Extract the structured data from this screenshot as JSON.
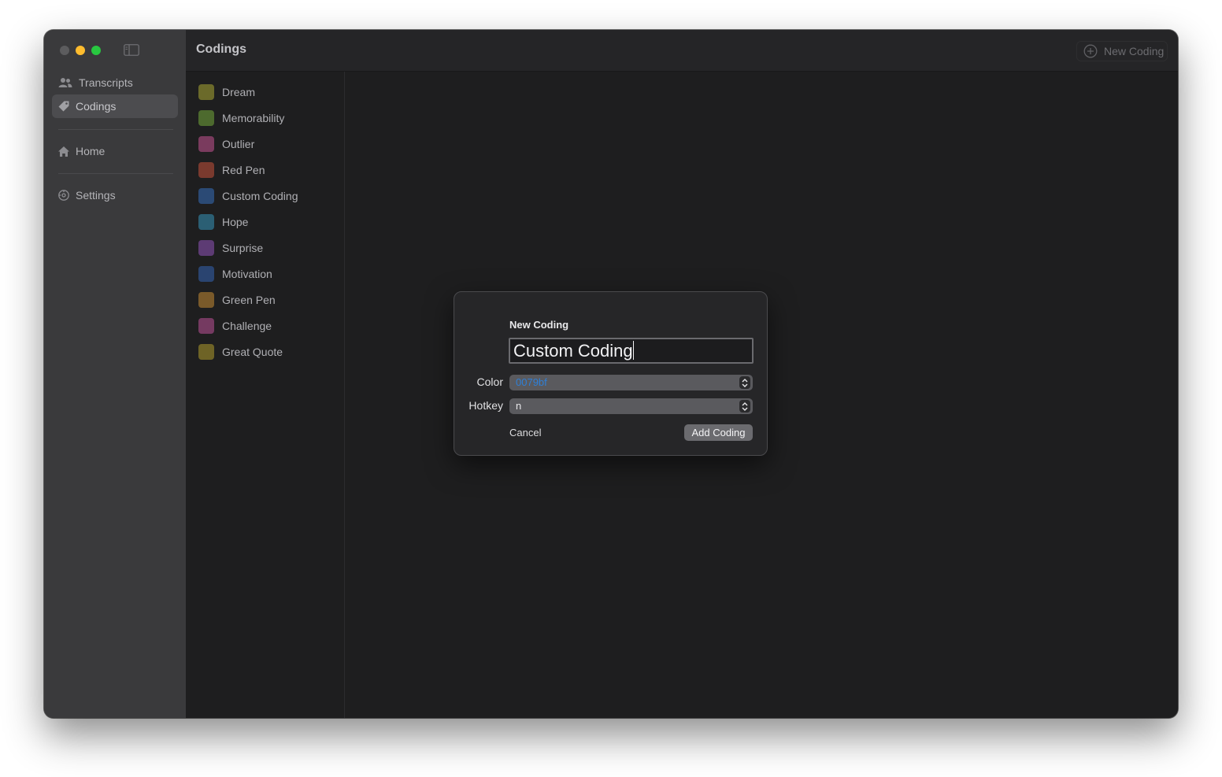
{
  "sidebar": {
    "items": [
      {
        "label": "Transcripts",
        "icon": "people-icon"
      },
      {
        "label": "Codings",
        "icon": "tag-icon",
        "selected": true
      },
      {
        "label": "Home",
        "icon": "house-icon"
      },
      {
        "label": "Settings",
        "icon": "gear-icon"
      }
    ]
  },
  "toolbar": {
    "title": "Codings",
    "new_coding_label": "New Coding"
  },
  "codings": [
    {
      "label": "Dream",
      "color": "#6b6a2a"
    },
    {
      "label": "Memorability",
      "color": "#4d6a2e"
    },
    {
      "label": "Outlier",
      "color": "#7a3b5e"
    },
    {
      "label": "Red Pen",
      "color": "#7a3a2e"
    },
    {
      "label": "Custom Coding",
      "color": "#2b4a75"
    },
    {
      "label": "Hope",
      "color": "#2b5f74"
    },
    {
      "label": "Surprise",
      "color": "#5d3b74"
    },
    {
      "label": "Motivation",
      "color": "#2a4470"
    },
    {
      "label": "Green Pen",
      "color": "#7a5a2a"
    },
    {
      "label": "Challenge",
      "color": "#753a61"
    },
    {
      "label": "Great Quote",
      "color": "#6e6326"
    }
  ],
  "dialog": {
    "title": "New Coding",
    "name_value": "Custom Coding",
    "color_label": "Color",
    "color_value": "0079bf",
    "hotkey_label": "Hotkey",
    "hotkey_value": "n",
    "cancel_label": "Cancel",
    "add_label": "Add Coding"
  },
  "colors": {
    "accent_link": "#2f7fd6",
    "window_bg": "#1e1e1f",
    "sidebar_bg": "#3a3a3c"
  }
}
